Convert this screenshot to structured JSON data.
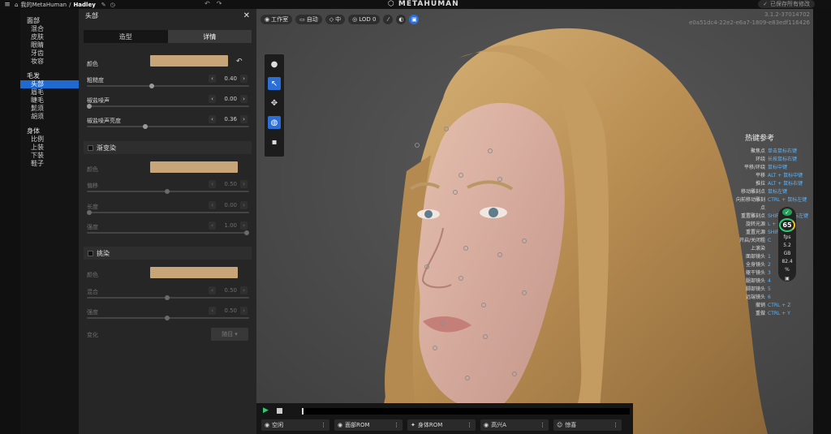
{
  "topbar": {
    "crumb_root": "我的MetaHuman",
    "crumb_sep": "/",
    "crumb_current": "Hadley",
    "brand": "METAHUMAN",
    "saved_label": "已保存所有修改"
  },
  "nav": {
    "face_title": "面部",
    "face_items": [
      "混合",
      "皮肤",
      "眼睛",
      "牙齿",
      "妆容"
    ],
    "hair_title": "毛发",
    "hair_items": [
      "头部",
      "眉毛",
      "睫毛",
      "髭须",
      "胡须"
    ],
    "body_title": "身体",
    "body_items": [
      "比例",
      "上装",
      "下装",
      "鞋子"
    ]
  },
  "panel": {
    "title": "头部",
    "tab_shape": "造型",
    "tab_detail": "详情",
    "color_label": "颜色",
    "roughness_label": "粗糙度",
    "roughness_value": "0.40",
    "salt_label": "椒盐噪声",
    "salt_value": "0.00",
    "salt_bright_label": "椒盐噪声亮度",
    "salt_bright_value": "0.36",
    "gradient_title": "渐变染",
    "g_color_label": "颜色",
    "g_offset_label": "偏移",
    "g_offset_value": "0.50",
    "g_length_label": "长度",
    "g_length_value": "0.00",
    "g_strength_label": "强度",
    "g_strength_value": "1.00",
    "highlight_title": "挑染",
    "h_color_label": "颜色",
    "h_amount_label": "混合",
    "h_amount_value": "0.50",
    "h_strength_label": "强度",
    "h_strength_value": "0.50",
    "variation_label": "变化",
    "variation_value": "随目"
  },
  "viewport": {
    "tool_studio": "工作室",
    "tool_auto": "自动",
    "tool_mid": "中",
    "tool_lod": "LOD 0",
    "version_line1": "3.1.2-37014702",
    "version_line2": "e0a51dc4-22e2-e6a7-1809-e83edf116426",
    "hotkeys_title": "热键参考",
    "hotkeys": [
      {
        "a": "聚焦点",
        "b": "单击鼠标右键"
      },
      {
        "a": "环绕",
        "b": "长按鼠标右键"
      },
      {
        "a": "平移/环绕",
        "b": "鼠标中键"
      },
      {
        "a": "平移",
        "b": "ALT + 鼠标中键"
      },
      {
        "a": "推拉",
        "b": "ALT + 鼠标右键"
      },
      {
        "a": "移动雕刻点",
        "b": "鼠标左键"
      },
      {
        "a": "向前移动雕刻点",
        "b": "CTRL + 鼠标左键"
      },
      {
        "a": "重置雕刻点",
        "b": "SHIFT + 鼠标左键"
      },
      {
        "a": "",
        "b": ""
      },
      {
        "a": "旋转光源",
        "b": "L + 鼠标"
      },
      {
        "a": "重置光源",
        "b": "SHIFT + L"
      },
      {
        "a": "开启/关闭粗上滚染",
        "b": "C"
      },
      {
        "a": "",
        "b": ""
      },
      {
        "a": "面部镜头",
        "b": "1"
      },
      {
        "a": "全身镜头",
        "b": "2"
      },
      {
        "a": "躯干镜头",
        "b": "3"
      },
      {
        "a": "腿部镜头",
        "b": "4"
      },
      {
        "a": "脚部镜头",
        "b": "5"
      },
      {
        "a": "远端镜头",
        "b": "6"
      },
      {
        "a": "",
        "b": ""
      },
      {
        "a": "撤销",
        "b": "CTRL + Z"
      },
      {
        "a": "重做",
        "b": "CTRL + Y"
      }
    ],
    "fps": "65",
    "fps_unit": "fps",
    "stat1": "5.2",
    "stat1_unit": "GB",
    "stat2": "82.4",
    "stat2_unit": "%"
  },
  "playback": {
    "sel1": "空闲",
    "sel2": "面部ROM",
    "sel3": "身体ROM",
    "sel4": "高兴A",
    "sel5": "惊喜"
  },
  "colors": {
    "accent": "#1e6ad0",
    "hair_swatch": "#c7a579",
    "play": "#2ecc71"
  }
}
